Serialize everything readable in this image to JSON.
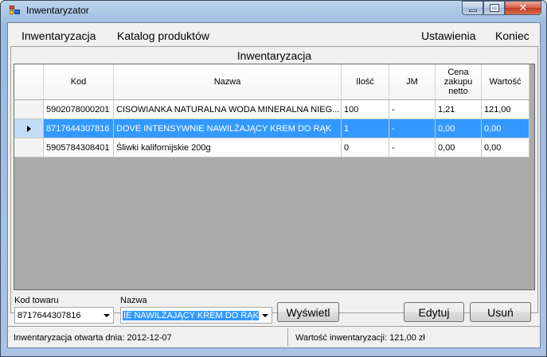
{
  "window": {
    "title": "Inwentaryzator"
  },
  "menu": {
    "left": [
      "Inwentaryzacja",
      "Katalog produktów"
    ],
    "right": [
      "Ustawienia",
      "Koniec"
    ]
  },
  "panel": {
    "title": "Inwentaryzacja"
  },
  "grid": {
    "columns": [
      "Kod",
      "Nazwa",
      "Ilość",
      "JM",
      "Cena zakupu netto",
      "Wartość"
    ],
    "rows": [
      {
        "kod": "5902078000201",
        "nazwa": "CISOWIANKA NATURALNA WODA MINERALNA NIEG...",
        "ilosc": "100",
        "jm": "-",
        "cena": "1,21",
        "wartosc": "121,00",
        "selected": false
      },
      {
        "kod": "8717644307816",
        "nazwa": "DOVE INTENSYWNIE NAWILŻAJĄCY KREM DO RĄK",
        "ilosc": "1",
        "jm": "-",
        "cena": "0,00",
        "wartosc": "0,00",
        "selected": true
      },
      {
        "kod": "5905784308401",
        "nazwa": "Śliwki kalifornijskie 200g",
        "ilosc": "0",
        "jm": "-",
        "cena": "0,00",
        "wartosc": "0,00",
        "selected": false
      }
    ]
  },
  "filters": {
    "kod_label": "Kod towaru",
    "kod_value": "8717644307816",
    "nazwa_label": "Nazwa",
    "nazwa_value": "IE NAWILŻAJĄCY KREM DO RĄK"
  },
  "buttons": {
    "show": "Wyświetl",
    "edit": "Edytuj",
    "delete": "Usuń"
  },
  "status": {
    "opened": "Inwentaryzacja otwarta dnia: 2012-12-07",
    "value": "Wartość inwentaryzacji: 121,00 zł"
  }
}
